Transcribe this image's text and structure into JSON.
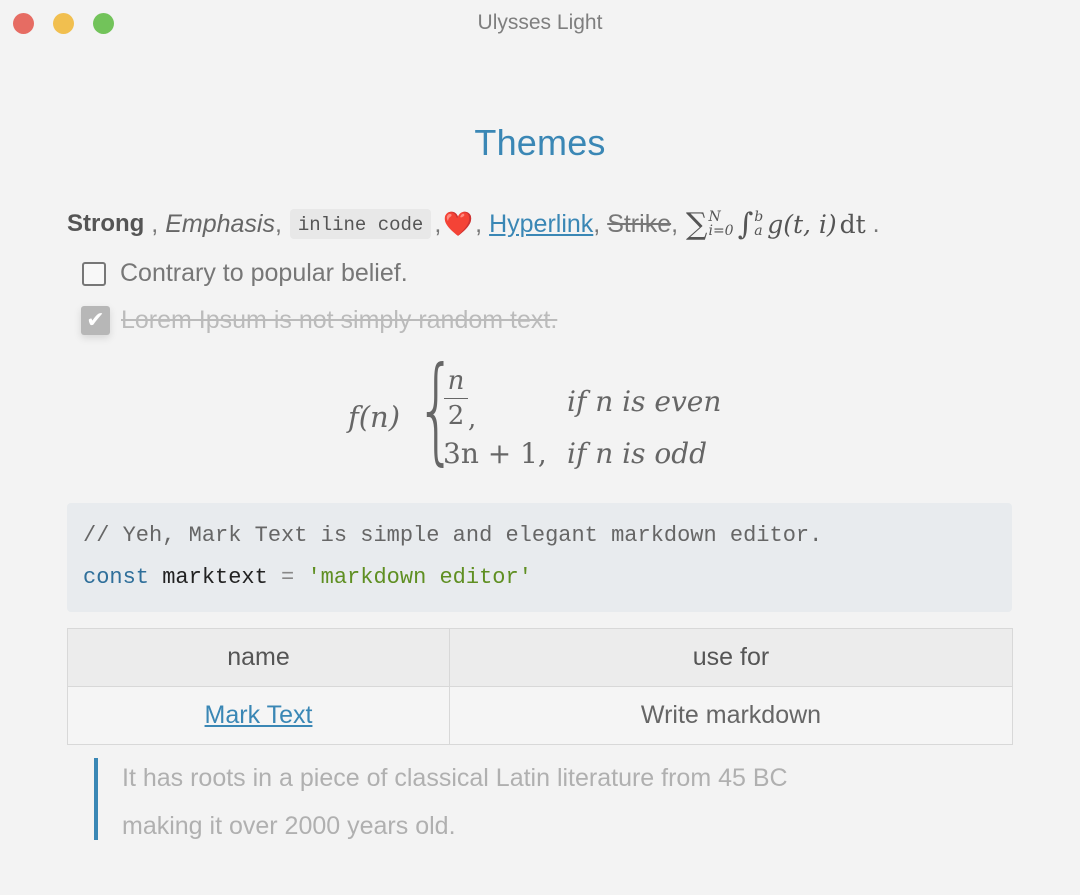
{
  "window": {
    "title": "Ulysses Light"
  },
  "document": {
    "title": "Themes",
    "inline": {
      "strong": "Strong",
      "comma_space": ",",
      "emphasis": "Emphasis",
      "comma": ",",
      "inline_code": "inline code",
      "heart": "❤️",
      "hyperlink": "Hyperlink",
      "strike": "Strike",
      "period": ".",
      "math": {
        "sum_symbol": "∑",
        "sum_upper": "N",
        "sum_lower": "i=0",
        "int_symbol": "∫",
        "int_upper": "b",
        "int_lower": "a",
        "expr": "g(t, i)",
        "diff": "dt"
      }
    },
    "tasks": [
      {
        "label": "Contrary to popular belief.",
        "checked": false
      },
      {
        "label": "Lorem Ipsum is not simply random text.",
        "checked": true,
        "check_glyph": "✔"
      }
    ],
    "formula": {
      "lhs": "f(n)",
      "brace": "{",
      "case1_num": "n",
      "case1_den": "2",
      "case1_comma": ",",
      "case1_cond": "if n is even",
      "case2_expr": "3n + 1,",
      "case2_cond": "if n is odd"
    },
    "code_block": {
      "comment": "// Yeh, Mark Text is simple and elegant markdown editor.",
      "keyword": "const",
      "variable": "marktext",
      "operator": "=",
      "string": "'markdown editor'"
    },
    "table": {
      "headers": [
        "name",
        "use for"
      ],
      "rows": [
        {
          "name": "Mark Text",
          "use_for": "Write markdown"
        }
      ]
    },
    "blockquote": {
      "line1": "It has roots in a piece of classical Latin literature from 45 BC",
      "line2": "making it over 2000 years old."
    }
  },
  "colors": {
    "accent": "#3a87b5",
    "background": "#f3f3f3",
    "traffic_close": "#e66c63",
    "traffic_minimize": "#f1bf4f",
    "traffic_zoom": "#72c35a",
    "code_string": "#5f8f22",
    "code_keyword": "#2f6f9a"
  }
}
